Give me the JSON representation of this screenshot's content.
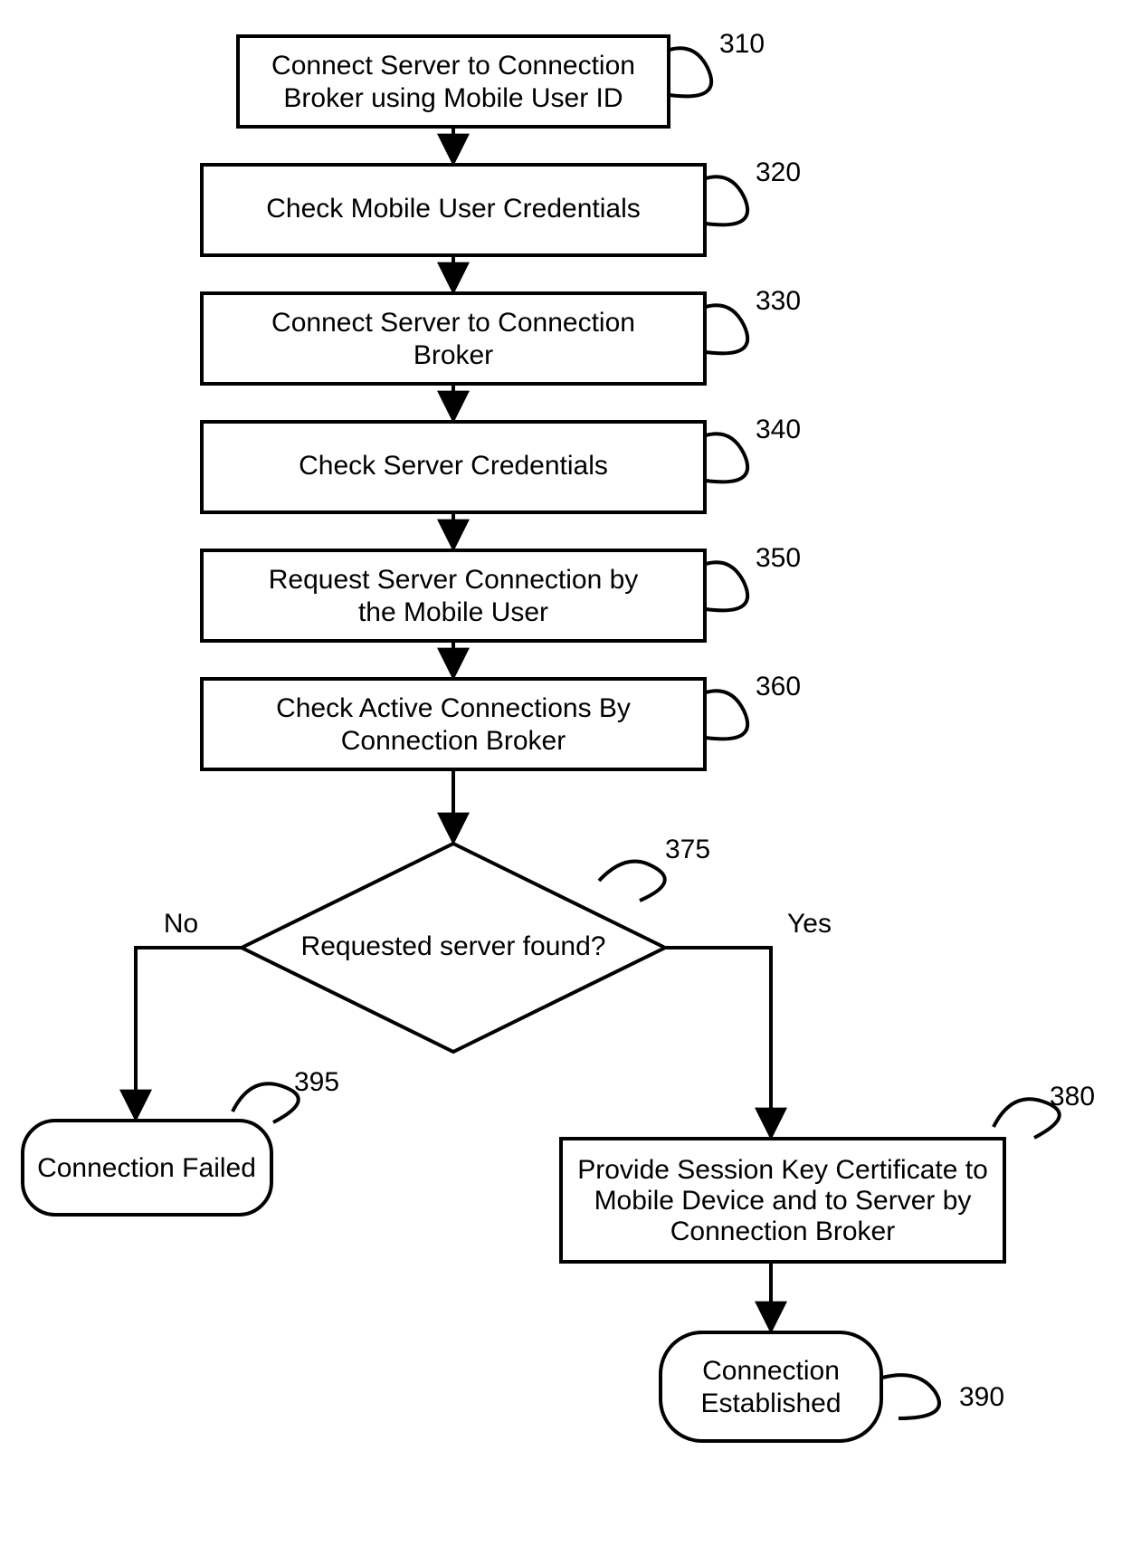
{
  "nodes": {
    "n310": {
      "ref": "310",
      "line1": "Connect Server to Connection",
      "line2": "Broker using Mobile User ID"
    },
    "n320": {
      "ref": "320",
      "line1": "Check Mobile User Credentials"
    },
    "n330": {
      "ref": "330",
      "line1": "Connect Server to Connection",
      "line2": "Broker"
    },
    "n340": {
      "ref": "340",
      "line1": "Check Server Credentials"
    },
    "n350": {
      "ref": "350",
      "line1": "Request Server Connection by",
      "line2": "the Mobile User"
    },
    "n360": {
      "ref": "360",
      "line1": "Check Active Connections By",
      "line2": "Connection Broker"
    },
    "n375": {
      "ref": "375",
      "line1": "Requested server found?"
    },
    "n380": {
      "ref": "380",
      "line1": "Provide Session Key Certificate to",
      "line2": "Mobile Device and to Server by",
      "line3": "Connection Broker"
    },
    "n390": {
      "ref": "390",
      "line1": "Connection",
      "line2": "Established"
    },
    "n395": {
      "ref": "395",
      "line1": "Connection Failed"
    }
  },
  "branches": {
    "no": "No",
    "yes": "Yes"
  }
}
